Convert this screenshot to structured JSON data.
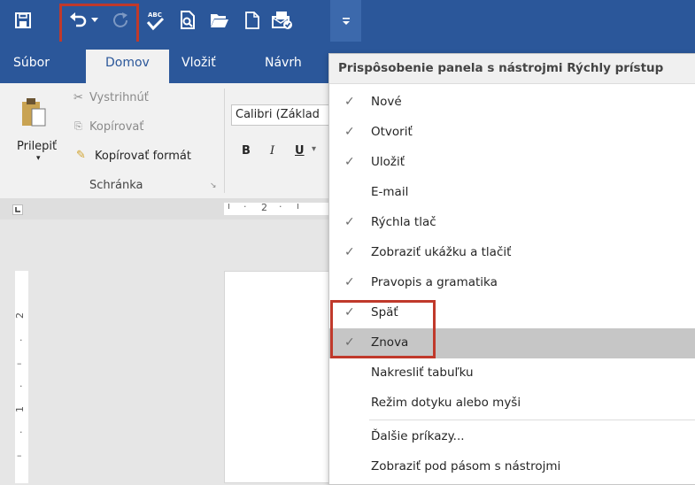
{
  "qat": {
    "icons": [
      "save-icon",
      "undo-icon",
      "undo-dropdown-icon",
      "redo-icon",
      "spelling-icon",
      "print-preview-icon",
      "open-folder-icon",
      "new-document-icon",
      "email-icon",
      "customize-qat-icon"
    ]
  },
  "tabs": {
    "file": "Súbor",
    "home": "Domov",
    "insert": "Vložiť",
    "design": "Návrh"
  },
  "ribbon": {
    "cut": "Vystrihnúť",
    "copy": "Kopírovať",
    "paste": "Prilepiť",
    "format_painter": "Kopírovať formát",
    "group_clipboard": "Schránka",
    "font_name": "Calibri (Základ",
    "bold": "B",
    "italic": "I",
    "underline": "U"
  },
  "ruler": {
    "h_label": "2",
    "v_label_1": "2",
    "v_label_2": "1"
  },
  "menu": {
    "title": "Prispôsobenie panela s nástrojmi Rýchly prístup",
    "items": [
      {
        "label": "Nové",
        "checked": "✓"
      },
      {
        "label": "Otvoriť",
        "checked": "✓"
      },
      {
        "label": "Uložiť",
        "checked": "✓"
      },
      {
        "label": "E-mail",
        "checked": ""
      },
      {
        "label": "Rýchla tlač",
        "checked": "✓"
      },
      {
        "label": "Zobraziť ukážku a tlačiť",
        "checked": "✓"
      },
      {
        "label": "Pravopis a gramatika",
        "checked": "✓"
      },
      {
        "label": "Späť",
        "checked": "✓"
      },
      {
        "label": "Znova",
        "checked": "✓"
      },
      {
        "label": "Nakresliť tabuľku",
        "checked": ""
      },
      {
        "label": "Režim dotyku alebo myši",
        "checked": ""
      },
      {
        "label": "Ďalšie príkazy...",
        "checked": ""
      },
      {
        "label": "Zobraziť pod pásom s nástrojmi",
        "checked": ""
      }
    ]
  },
  "colors": {
    "title_bar": "#2b579a",
    "highlight": "#c6c6c6",
    "annotation": "#c0392b"
  }
}
